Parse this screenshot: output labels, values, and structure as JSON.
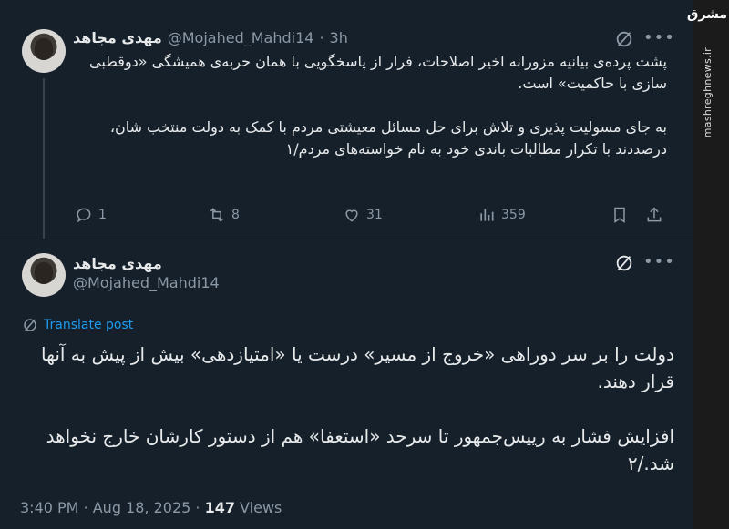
{
  "watermark": {
    "logo": "مشرق",
    "site": "mashreghnews.ir"
  },
  "tweet1": {
    "display_name": "مهدی مجاهد",
    "handle": "@Mojahed_Mahdi14",
    "separator": "·",
    "time": "3h",
    "paragraphs": [
      "پشت پرده‌ی بیانیه مزورانه اخیر اصلاحات، فرار از پاسخگویی با همان حربه‌ی همیشگی «دوقطبی سازی با حاکمیت» است.",
      "به جای مسولیت پذیری و تلاش برای حل مسائل معیشتی مردم با کمک به دولت منتخب شان، درصددند با تکرار مطالبات باندی خود به نام خواسته‌های مردم/۱"
    ],
    "actions": {
      "replies": "1",
      "reposts": "8",
      "likes": "31",
      "views": "359"
    }
  },
  "tweet2": {
    "display_name": "مهدی مجاهد",
    "handle": "@Mojahed_Mahdi14",
    "translate_label": "Translate post",
    "paragraphs": [
      "دولت را بر سر دوراهی «خروج از مسیر» درست یا «امتیازدهی» بیش از پیش به آنها قرار دهند.",
      "افزایش فشار به رییس‌جمهور تا سرحد «استعفا» هم از دستور کارشان خارج نخواهد شد./۲"
    ],
    "timestamp": "3:40 PM · Aug 18, 2025 · ",
    "views_count": "147",
    "views_label": " Views"
  },
  "icons": [
    "grok-icon",
    "more-icon",
    "reply-icon",
    "repost-icon",
    "like-icon",
    "views-icon",
    "bookmark-icon",
    "share-icon",
    "translate-icon"
  ],
  "colors": {
    "background": "#15202b",
    "text": "#e7e9ea",
    "muted": "#8b98a5",
    "link": "#1d9bf0",
    "border": "#38444d"
  }
}
